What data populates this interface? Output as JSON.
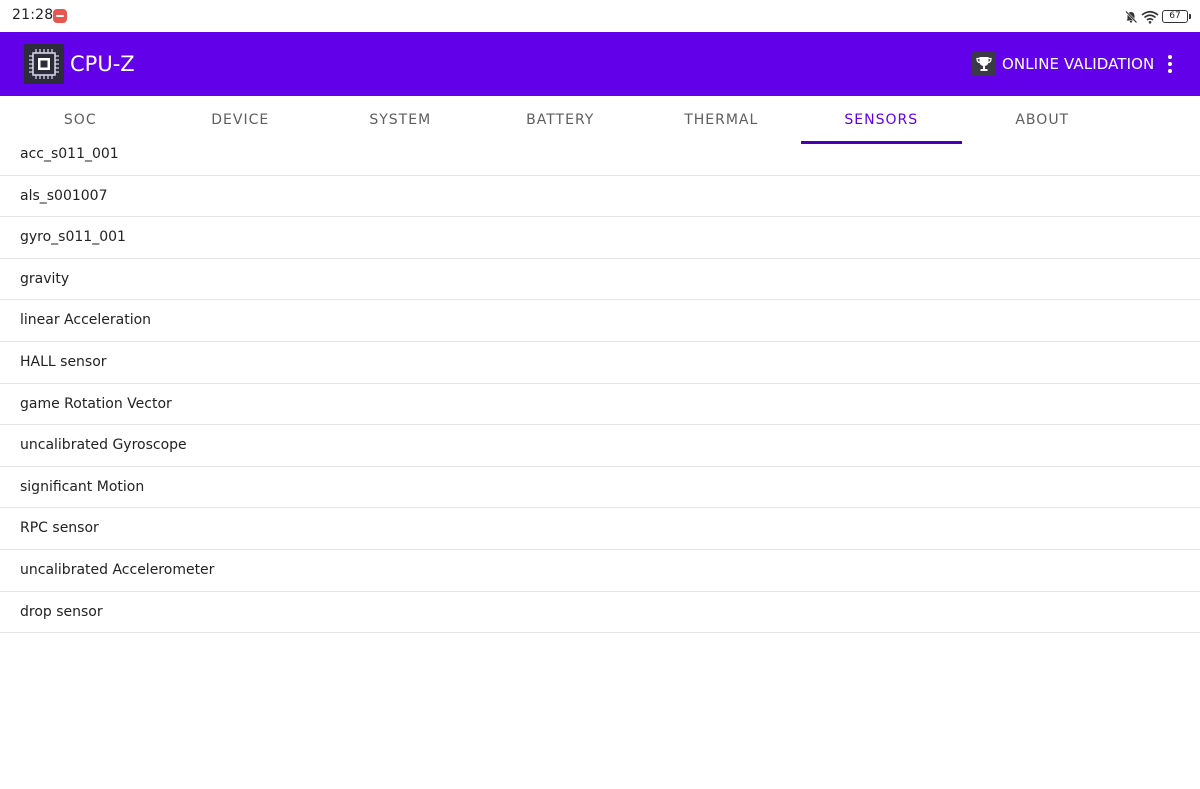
{
  "status_bar": {
    "time": "21:28",
    "battery": "67"
  },
  "app_bar": {
    "title": "CPU-Z",
    "validation_label": "ONLINE VALIDATION",
    "color": "#6200ea"
  },
  "tabs": [
    {
      "label": "SOC"
    },
    {
      "label": "DEVICE"
    },
    {
      "label": "SYSTEM"
    },
    {
      "label": "BATTERY"
    },
    {
      "label": "THERMAL"
    },
    {
      "label": "SENSORS",
      "active": true
    },
    {
      "label": "ABOUT"
    }
  ],
  "sensors": [
    "acc_s011_001",
    "als_s001007",
    "gyro_s011_001",
    "gravity",
    "linear Acceleration",
    "HALL sensor",
    "game Rotation Vector",
    "uncalibrated Gyroscope",
    "significant Motion",
    "RPC sensor",
    "uncalibrated Accelerometer",
    "drop sensor"
  ]
}
